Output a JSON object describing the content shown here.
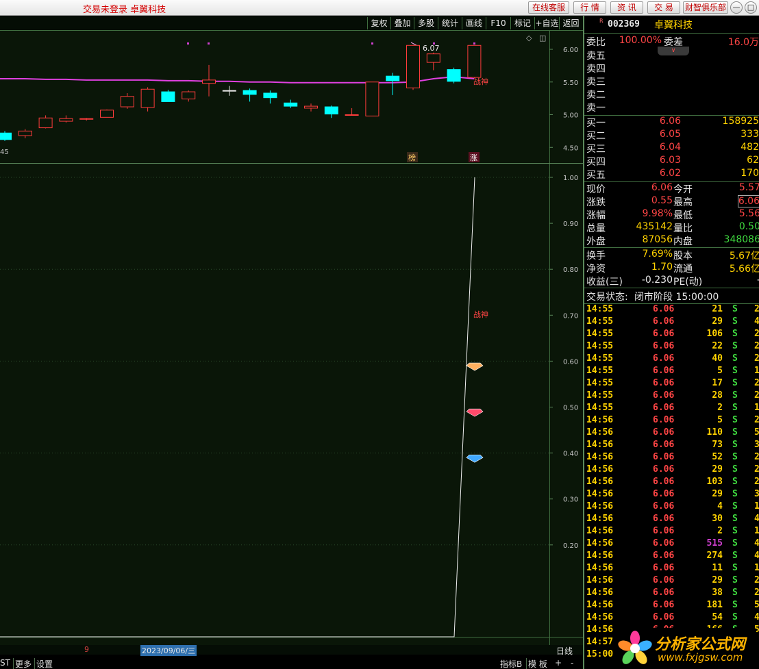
{
  "app": {
    "title": "交易未登录 卓翼科技",
    "buttons": [
      "在线客服",
      "行 情",
      "资 讯",
      "交 易",
      "财智俱乐部"
    ],
    "window_controls": [
      "minimize",
      "restore"
    ]
  },
  "toolbar": {
    "items": [
      "复权",
      "叠加",
      "多股",
      "统计",
      "画线",
      "F10",
      "标记",
      "+自选",
      "返回"
    ]
  },
  "kline": {
    "y_ticks": [
      "6.00",
      "5.50",
      "5.00",
      "4.50"
    ],
    "low_label": "45",
    "high_label": "6.07",
    "marker_text": "战神",
    "tags": [
      "榜",
      "涨"
    ]
  },
  "indicator": {
    "y_ticks": [
      "1.00",
      "0.90",
      "0.80",
      "0.70",
      "0.60",
      "0.50",
      "0.40",
      "0.30",
      "0.20"
    ],
    "marker_text": "战神"
  },
  "chart_data": {
    "type": "candlestick",
    "ylim": [
      4.3,
      6.2
    ],
    "ylabel": "",
    "candles": [
      {
        "open": 4.62,
        "close": 4.72,
        "high": 4.75,
        "low": 4.6,
        "color": "cyan"
      },
      {
        "open": 4.68,
        "close": 4.75,
        "high": 4.78,
        "low": 4.64,
        "color": "red"
      },
      {
        "open": 4.8,
        "close": 4.95,
        "high": 4.99,
        "low": 4.79,
        "color": "red"
      },
      {
        "open": 4.9,
        "close": 4.94,
        "high": 4.99,
        "low": 4.88,
        "color": "red"
      },
      {
        "open": 4.93,
        "close": 4.94,
        "high": 4.95,
        "low": 4.91,
        "color": "red"
      },
      {
        "open": 4.96,
        "close": 5.07,
        "high": 5.08,
        "low": 4.96,
        "color": "red"
      },
      {
        "open": 5.12,
        "close": 5.28,
        "high": 5.33,
        "low": 5.09,
        "color": "red"
      },
      {
        "open": 5.11,
        "close": 5.39,
        "high": 5.42,
        "low": 5.05,
        "color": "red"
      },
      {
        "open": 5.35,
        "close": 5.2,
        "high": 5.38,
        "low": 5.2,
        "color": "cyan"
      },
      {
        "open": 5.24,
        "close": 5.35,
        "high": 5.37,
        "low": 5.2,
        "color": "red"
      },
      {
        "open": 5.48,
        "close": 5.53,
        "high": 5.76,
        "low": 5.28,
        "color": "red"
      },
      {
        "open": 5.37,
        "close": 5.37,
        "high": 5.44,
        "low": 5.29,
        "color": "white"
      },
      {
        "open": 5.37,
        "close": 5.31,
        "high": 5.4,
        "low": 5.2,
        "color": "cyan"
      },
      {
        "open": 5.33,
        "close": 5.26,
        "high": 5.37,
        "low": 5.17,
        "color": "cyan"
      },
      {
        "open": 5.18,
        "close": 5.13,
        "high": 5.23,
        "low": 5.1,
        "color": "cyan"
      },
      {
        "open": 5.1,
        "close": 5.13,
        "high": 5.17,
        "low": 5.05,
        "color": "red"
      },
      {
        "open": 5.12,
        "close": 5.01,
        "high": 5.14,
        "low": 4.95,
        "color": "cyan"
      },
      {
        "open": 5.0,
        "close": 5.0,
        "high": 5.1,
        "low": 5.0,
        "color": "red"
      },
      {
        "open": 4.98,
        "close": 5.5,
        "high": 5.5,
        "low": 4.98,
        "color": "red"
      },
      {
        "open": 5.59,
        "close": 5.52,
        "high": 5.64,
        "low": 5.3,
        "color": "cyan"
      },
      {
        "open": 5.41,
        "close": 6.06,
        "high": 6.07,
        "low": 5.38,
        "color": "red"
      },
      {
        "open": 5.8,
        "close": 5.93,
        "high": 5.95,
        "low": 5.68,
        "color": "red"
      },
      {
        "open": 5.69,
        "close": 5.51,
        "high": 5.72,
        "low": 5.48,
        "color": "cyan"
      },
      {
        "open": 5.57,
        "close": 6.06,
        "high": 6.06,
        "low": 5.56,
        "color": "red"
      }
    ],
    "ma": [
      5.55,
      5.55,
      5.54,
      5.54,
      5.53,
      5.53,
      5.53,
      5.53,
      5.52,
      5.52,
      5.51,
      5.51,
      5.5,
      5.5,
      5.49,
      5.49,
      5.49,
      5.49,
      5.49,
      5.49,
      5.5,
      5.55,
      5.58,
      5.55
    ],
    "indicator": {
      "ylim": [
        0.0,
        1.0
      ],
      "values": [
        0.0,
        0.0,
        0.0,
        0.0,
        0.0,
        0.0,
        0.0,
        0.0,
        0.0,
        0.0,
        0.0,
        0.0,
        0.0,
        0.0,
        0.0,
        0.0,
        0.0,
        0.0,
        0.0,
        0.0,
        0.0,
        0.0,
        0.0,
        1.0
      ],
      "gems": [
        0.59,
        0.49,
        0.39
      ]
    }
  },
  "stock": {
    "badge": "R",
    "code": "002369",
    "name": "卓翼科技"
  },
  "order_book": {
    "ratio_label": "委比",
    "ratio_value": "100.00%",
    "diff_label": "委差",
    "diff_value": "16.0万",
    "asks": [
      {
        "label": "卖五",
        "price": "",
        "vol": ""
      },
      {
        "label": "卖四",
        "price": "",
        "vol": ""
      },
      {
        "label": "卖三",
        "price": "",
        "vol": ""
      },
      {
        "label": "卖二",
        "price": "",
        "vol": ""
      },
      {
        "label": "卖一",
        "price": "",
        "vol": ""
      }
    ],
    "bids": [
      {
        "label": "买一",
        "price": "6.06",
        "vol": "158925"
      },
      {
        "label": "买二",
        "price": "6.05",
        "vol": "333"
      },
      {
        "label": "买三",
        "price": "6.04",
        "vol": "482"
      },
      {
        "label": "买四",
        "price": "6.03",
        "vol": "62"
      },
      {
        "label": "买五",
        "price": "6.02",
        "vol": "170"
      }
    ]
  },
  "quote": {
    "rows": [
      {
        "l1": "现价",
        "v1": "6.06",
        "l2": "今开",
        "v2": "5.57"
      },
      {
        "l1": "涨跌",
        "v1": "0.55",
        "l2": "最高",
        "v2": "6.06"
      },
      {
        "l1": "涨幅",
        "v1": "9.98%",
        "l2": "最低",
        "v2": "5.56"
      },
      {
        "l1": "总量",
        "v1": "435142",
        "l2": "量比",
        "v2": "0.50"
      },
      {
        "l1": "外盘",
        "v1": "87056",
        "l2": "内盘",
        "v2": "348086"
      }
    ],
    "rows2": [
      {
        "l1": "换手",
        "v1": "7.69%",
        "l2": "股本",
        "v2": "5.67亿"
      },
      {
        "l1": "净资",
        "v1": "1.70",
        "l2": "流通",
        "v2": "5.66亿"
      },
      {
        "l1": "收益(三)",
        "v1": "-0.230",
        "l2": "PE(动)",
        "v2": "-"
      }
    ],
    "status_label": "交易状态:",
    "status_value": "闭市阶段 15:00:00"
  },
  "ticks": [
    {
      "time": "14:55",
      "price": "6.06",
      "vol": "21",
      "side": "S",
      "n": "2"
    },
    {
      "time": "14:55",
      "price": "6.06",
      "vol": "29",
      "side": "S",
      "n": "4"
    },
    {
      "time": "14:55",
      "price": "6.06",
      "vol": "106",
      "side": "S",
      "n": "2"
    },
    {
      "time": "14:55",
      "price": "6.06",
      "vol": "22",
      "side": "S",
      "n": "2"
    },
    {
      "time": "14:55",
      "price": "6.06",
      "vol": "40",
      "side": "S",
      "n": "2"
    },
    {
      "time": "14:55",
      "price": "6.06",
      "vol": "5",
      "side": "S",
      "n": "1"
    },
    {
      "time": "14:55",
      "price": "6.06",
      "vol": "17",
      "side": "S",
      "n": "2"
    },
    {
      "time": "14:55",
      "price": "6.06",
      "vol": "28",
      "side": "S",
      "n": "2"
    },
    {
      "time": "14:55",
      "price": "6.06",
      "vol": "2",
      "side": "S",
      "n": "1"
    },
    {
      "time": "14:56",
      "price": "6.06",
      "vol": "5",
      "side": "S",
      "n": "2"
    },
    {
      "time": "14:56",
      "price": "6.06",
      "vol": "110",
      "side": "S",
      "n": "5"
    },
    {
      "time": "14:56",
      "price": "6.06",
      "vol": "73",
      "side": "S",
      "n": "3"
    },
    {
      "time": "14:56",
      "price": "6.06",
      "vol": "52",
      "side": "S",
      "n": "2"
    },
    {
      "time": "14:56",
      "price": "6.06",
      "vol": "29",
      "side": "S",
      "n": "2"
    },
    {
      "time": "14:56",
      "price": "6.06",
      "vol": "103",
      "side": "S",
      "n": "2"
    },
    {
      "time": "14:56",
      "price": "6.06",
      "vol": "29",
      "side": "S",
      "n": "3"
    },
    {
      "time": "14:56",
      "price": "6.06",
      "vol": "4",
      "side": "S",
      "n": "1"
    },
    {
      "time": "14:56",
      "price": "6.06",
      "vol": "30",
      "side": "S",
      "n": "4"
    },
    {
      "time": "14:56",
      "price": "6.06",
      "vol": "2",
      "side": "S",
      "n": "1"
    },
    {
      "time": "14:56",
      "price": "6.06",
      "vol": "515",
      "side": "S",
      "n": "4"
    },
    {
      "time": "14:56",
      "price": "6.06",
      "vol": "274",
      "side": "S",
      "n": "4"
    },
    {
      "time": "14:56",
      "price": "6.06",
      "vol": "11",
      "side": "S",
      "n": "1"
    },
    {
      "time": "14:56",
      "price": "6.06",
      "vol": "29",
      "side": "S",
      "n": "2"
    },
    {
      "time": "14:56",
      "price": "6.06",
      "vol": "38",
      "side": "S",
      "n": "2"
    },
    {
      "time": "14:56",
      "price": "6.06",
      "vol": "181",
      "side": "S",
      "n": "5"
    },
    {
      "time": "14:56",
      "price": "6.06",
      "vol": "54",
      "side": "S",
      "n": "4"
    },
    {
      "time": "14:56",
      "price": "6.06",
      "vol": "166",
      "side": "S",
      "n": "5"
    },
    {
      "time": "14:57",
      "price": "",
      "vol": "",
      "side": "",
      "n": ""
    },
    {
      "time": "15:00",
      "price": "",
      "vol": "",
      "side": "",
      "n": ""
    }
  ],
  "bottombar": {
    "date_marker": "9",
    "date": "2023/09/06/三",
    "period": "日线",
    "tabs": [
      "ST",
      "更多",
      "设置"
    ],
    "right_items": [
      "指标B",
      "模 板",
      "+",
      "-"
    ]
  },
  "watermark": {
    "title": "分析家公式网",
    "url": "www.fxjgsw.com"
  }
}
